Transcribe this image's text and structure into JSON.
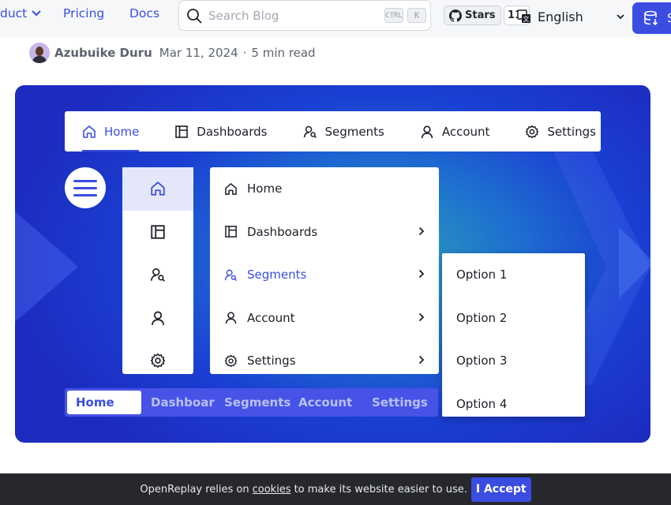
{
  "nav": {
    "product_label": "duct",
    "pricing_label": "Pricing",
    "docs_label": "Docs",
    "search_placeholder": "Search Blog",
    "shortcut_ctrl": "CTRL",
    "shortcut_k": "K",
    "github_label": "Stars",
    "github_count": "11.",
    "language": "English",
    "cta_label": "S"
  },
  "author": {
    "name": "Azubuike Duru",
    "date": "Mar 11, 2024",
    "separator": "·",
    "read_time": "5 min read"
  },
  "hero": {
    "top_menu": [
      {
        "label": "Home",
        "icon": "home-icon"
      },
      {
        "label": "Dashboards",
        "icon": "dashboard-icon"
      },
      {
        "label": "Segments",
        "icon": "segments-icon"
      },
      {
        "label": "Account",
        "icon": "user-icon"
      },
      {
        "label": "Settings",
        "icon": "gear-icon"
      }
    ],
    "side_menu": [
      {
        "label": "Home"
      },
      {
        "label": "Dashboards"
      },
      {
        "label": "Segments"
      },
      {
        "label": "Account"
      },
      {
        "label": "Settings"
      }
    ],
    "sub_menu": [
      "Option 1",
      "Option 2",
      "Option 3",
      "Option 4"
    ],
    "tabs": [
      "Home",
      "Dashboards",
      "Segments",
      "Account",
      "Settings"
    ],
    "colors": {
      "accent": "#3b4de0",
      "tab_bar": "#4653e6",
      "background": "#1d2bbf"
    }
  },
  "cookie": {
    "text_before": "OpenReplay relies on",
    "link": "cookies",
    "text_after": "to make its website easier to use.",
    "button": "I Accept"
  }
}
